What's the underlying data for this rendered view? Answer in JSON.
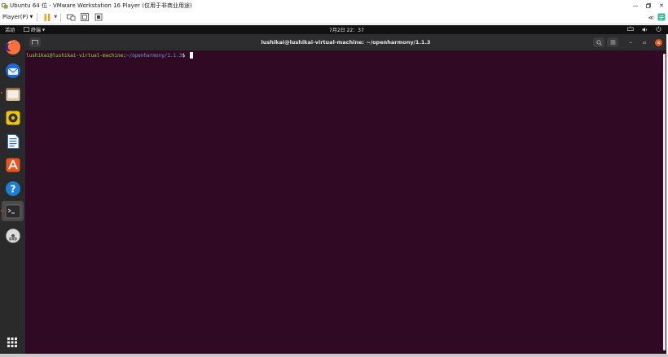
{
  "window": {
    "title": "Ubuntu 64 位 - VMware Workstation 16 Player (仅用于非商业用途)",
    "controls": [
      "minimize-icon",
      "restore-icon",
      "close-icon"
    ]
  },
  "toolbar": {
    "player_menu_label": "Player(P)",
    "items": [
      "pause-icon",
      "send-ctrl-alt-del-icon",
      "fit-guest-icon",
      "fullscreen-icon",
      "unity-icon"
    ],
    "right_items": [
      "back-arrows-icon",
      "library-icon"
    ],
    "accent_color": "#f39c12"
  },
  "gnome": {
    "activities_label": "活动",
    "app_label": "终端",
    "clock": "7月2日 22：37",
    "tray": [
      "network-icon",
      "volume-icon",
      "power-icon"
    ]
  },
  "dock": {
    "items": [
      {
        "name": "firefox-icon"
      },
      {
        "name": "thunderbird-icon"
      },
      {
        "name": "files-icon"
      },
      {
        "name": "rhythmbox-icon"
      },
      {
        "name": "libreoffice-writer-icon"
      },
      {
        "name": "ubuntu-software-icon"
      },
      {
        "name": "help-icon"
      },
      {
        "name": "terminal-icon",
        "active": true
      },
      {
        "name": "dvd-icon"
      }
    ],
    "show_apps": "show-applications-icon"
  },
  "terminal": {
    "title": "lushikai@lushikai-virtual-machine: ~/openharmony/1.1.3",
    "prompt_user": "lushikai@lushikai-virtual-machine",
    "prompt_sep": ":",
    "prompt_path": "~/openharmony/1.1.3",
    "prompt_symbol": "$ ",
    "background": "#300a24",
    "user_color": "#8ae234",
    "path_color": "#729fcf"
  }
}
